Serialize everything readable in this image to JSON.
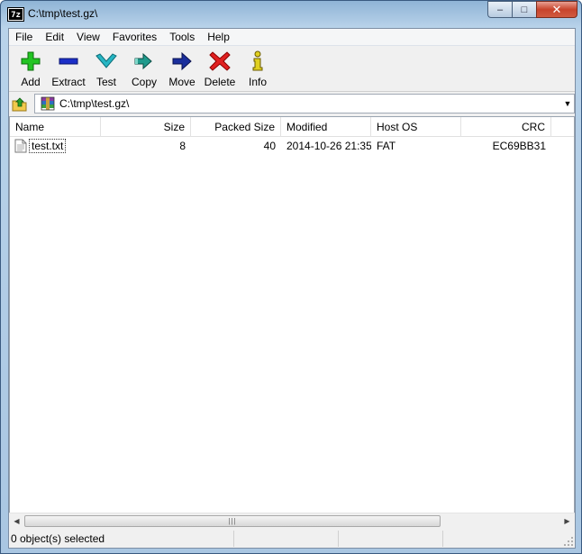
{
  "window": {
    "title": "C:\\tmp\\test.gz\\",
    "app_icon_text": "7z",
    "controls": {
      "minimize": "–",
      "maximize": "□",
      "close": "✕"
    }
  },
  "menu": [
    "File",
    "Edit",
    "View",
    "Favorites",
    "Tools",
    "Help"
  ],
  "toolbar": [
    {
      "label": "Add",
      "icon": "plus-icon",
      "color": "#22c422"
    },
    {
      "label": "Extract",
      "icon": "minus-icon",
      "color": "#1c2fc8"
    },
    {
      "label": "Test",
      "icon": "check-icon",
      "color": "#27b6c4"
    },
    {
      "label": "Copy",
      "icon": "double-arrow-icon",
      "color": "#1f9a8c"
    },
    {
      "label": "Move",
      "icon": "arrow-right-icon",
      "color": "#1a2e9c"
    },
    {
      "label": "Delete",
      "icon": "x-icon",
      "color": "#e02020"
    },
    {
      "label": "Info",
      "icon": "info-icon",
      "color": "#e0d020"
    }
  ],
  "address": {
    "path": "C:\\tmp\\test.gz\\",
    "dropdown": "▼"
  },
  "columns": {
    "name": "Name",
    "size": "Size",
    "packed": "Packed Size",
    "modified": "Modified",
    "host": "Host OS",
    "crc": "CRC"
  },
  "files": [
    {
      "name": "test.txt",
      "size": "8",
      "packed": "40",
      "modified": "2014-10-26 21:35",
      "host": "FAT",
      "crc": "EC69BB31"
    }
  ],
  "scrollbar": {
    "left_arrow": "◀",
    "right_arrow": "▶",
    "grip": "|||"
  },
  "status": {
    "selection": "0 object(s) selected",
    "seg2": "",
    "seg3": "",
    "seg4": ""
  }
}
